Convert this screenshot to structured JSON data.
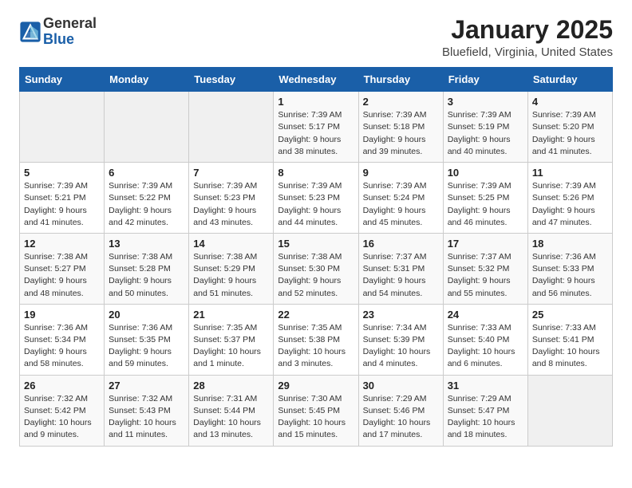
{
  "logo": {
    "line1": "General",
    "line2": "Blue"
  },
  "title": "January 2025",
  "subtitle": "Bluefield, Virginia, United States",
  "days_of_week": [
    "Sunday",
    "Monday",
    "Tuesday",
    "Wednesday",
    "Thursday",
    "Friday",
    "Saturday"
  ],
  "weeks": [
    [
      {
        "day": "",
        "info": ""
      },
      {
        "day": "",
        "info": ""
      },
      {
        "day": "",
        "info": ""
      },
      {
        "day": "1",
        "info": "Sunrise: 7:39 AM\nSunset: 5:17 PM\nDaylight: 9 hours and 38 minutes."
      },
      {
        "day": "2",
        "info": "Sunrise: 7:39 AM\nSunset: 5:18 PM\nDaylight: 9 hours and 39 minutes."
      },
      {
        "day": "3",
        "info": "Sunrise: 7:39 AM\nSunset: 5:19 PM\nDaylight: 9 hours and 40 minutes."
      },
      {
        "day": "4",
        "info": "Sunrise: 7:39 AM\nSunset: 5:20 PM\nDaylight: 9 hours and 41 minutes."
      }
    ],
    [
      {
        "day": "5",
        "info": "Sunrise: 7:39 AM\nSunset: 5:21 PM\nDaylight: 9 hours and 41 minutes."
      },
      {
        "day": "6",
        "info": "Sunrise: 7:39 AM\nSunset: 5:22 PM\nDaylight: 9 hours and 42 minutes."
      },
      {
        "day": "7",
        "info": "Sunrise: 7:39 AM\nSunset: 5:23 PM\nDaylight: 9 hours and 43 minutes."
      },
      {
        "day": "8",
        "info": "Sunrise: 7:39 AM\nSunset: 5:23 PM\nDaylight: 9 hours and 44 minutes."
      },
      {
        "day": "9",
        "info": "Sunrise: 7:39 AM\nSunset: 5:24 PM\nDaylight: 9 hours and 45 minutes."
      },
      {
        "day": "10",
        "info": "Sunrise: 7:39 AM\nSunset: 5:25 PM\nDaylight: 9 hours and 46 minutes."
      },
      {
        "day": "11",
        "info": "Sunrise: 7:39 AM\nSunset: 5:26 PM\nDaylight: 9 hours and 47 minutes."
      }
    ],
    [
      {
        "day": "12",
        "info": "Sunrise: 7:38 AM\nSunset: 5:27 PM\nDaylight: 9 hours and 48 minutes."
      },
      {
        "day": "13",
        "info": "Sunrise: 7:38 AM\nSunset: 5:28 PM\nDaylight: 9 hours and 50 minutes."
      },
      {
        "day": "14",
        "info": "Sunrise: 7:38 AM\nSunset: 5:29 PM\nDaylight: 9 hours and 51 minutes."
      },
      {
        "day": "15",
        "info": "Sunrise: 7:38 AM\nSunset: 5:30 PM\nDaylight: 9 hours and 52 minutes."
      },
      {
        "day": "16",
        "info": "Sunrise: 7:37 AM\nSunset: 5:31 PM\nDaylight: 9 hours and 54 minutes."
      },
      {
        "day": "17",
        "info": "Sunrise: 7:37 AM\nSunset: 5:32 PM\nDaylight: 9 hours and 55 minutes."
      },
      {
        "day": "18",
        "info": "Sunrise: 7:36 AM\nSunset: 5:33 PM\nDaylight: 9 hours and 56 minutes."
      }
    ],
    [
      {
        "day": "19",
        "info": "Sunrise: 7:36 AM\nSunset: 5:34 PM\nDaylight: 9 hours and 58 minutes."
      },
      {
        "day": "20",
        "info": "Sunrise: 7:36 AM\nSunset: 5:35 PM\nDaylight: 9 hours and 59 minutes."
      },
      {
        "day": "21",
        "info": "Sunrise: 7:35 AM\nSunset: 5:37 PM\nDaylight: 10 hours and 1 minute."
      },
      {
        "day": "22",
        "info": "Sunrise: 7:35 AM\nSunset: 5:38 PM\nDaylight: 10 hours and 3 minutes."
      },
      {
        "day": "23",
        "info": "Sunrise: 7:34 AM\nSunset: 5:39 PM\nDaylight: 10 hours and 4 minutes."
      },
      {
        "day": "24",
        "info": "Sunrise: 7:33 AM\nSunset: 5:40 PM\nDaylight: 10 hours and 6 minutes."
      },
      {
        "day": "25",
        "info": "Sunrise: 7:33 AM\nSunset: 5:41 PM\nDaylight: 10 hours and 8 minutes."
      }
    ],
    [
      {
        "day": "26",
        "info": "Sunrise: 7:32 AM\nSunset: 5:42 PM\nDaylight: 10 hours and 9 minutes."
      },
      {
        "day": "27",
        "info": "Sunrise: 7:32 AM\nSunset: 5:43 PM\nDaylight: 10 hours and 11 minutes."
      },
      {
        "day": "28",
        "info": "Sunrise: 7:31 AM\nSunset: 5:44 PM\nDaylight: 10 hours and 13 minutes."
      },
      {
        "day": "29",
        "info": "Sunrise: 7:30 AM\nSunset: 5:45 PM\nDaylight: 10 hours and 15 minutes."
      },
      {
        "day": "30",
        "info": "Sunrise: 7:29 AM\nSunset: 5:46 PM\nDaylight: 10 hours and 17 minutes."
      },
      {
        "day": "31",
        "info": "Sunrise: 7:29 AM\nSunset: 5:47 PM\nDaylight: 10 hours and 18 minutes."
      },
      {
        "day": "",
        "info": ""
      }
    ]
  ]
}
